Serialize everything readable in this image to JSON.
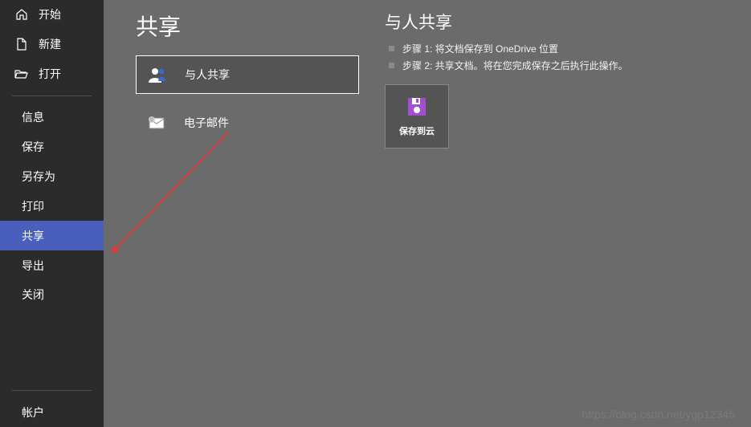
{
  "sidebar": {
    "groups": [
      {
        "key": "start",
        "label": "开始",
        "icon": "home-icon"
      },
      {
        "key": "new",
        "label": "新建",
        "icon": "document-icon"
      },
      {
        "key": "open",
        "label": "打开",
        "icon": "folder-open-icon"
      }
    ],
    "items": [
      {
        "key": "info",
        "label": "信息"
      },
      {
        "key": "save",
        "label": "保存"
      },
      {
        "key": "saveas",
        "label": "另存为"
      },
      {
        "key": "print",
        "label": "打印"
      },
      {
        "key": "share",
        "label": "共享",
        "selected": true
      },
      {
        "key": "export",
        "label": "导出"
      },
      {
        "key": "close",
        "label": "关闭"
      }
    ],
    "footer": [
      {
        "key": "account",
        "label": "帐户"
      }
    ]
  },
  "main": {
    "title": "共享",
    "options": [
      {
        "key": "share-people",
        "label": "与人共享",
        "icon": "people-icon",
        "selected": true
      },
      {
        "key": "email",
        "label": "电子邮件",
        "icon": "mail-icon"
      }
    ]
  },
  "detail": {
    "title": "与人共享",
    "steps": [
      "步骤 1: 将文档保存到 OneDrive 位置",
      "步骤 2: 共享文档。将在您完成保存之后执行此操作。"
    ],
    "cloud_button": {
      "label": "保存到云",
      "icon": "save-icon"
    }
  },
  "watermark": "https://blog.csdn.net/ygp12345"
}
